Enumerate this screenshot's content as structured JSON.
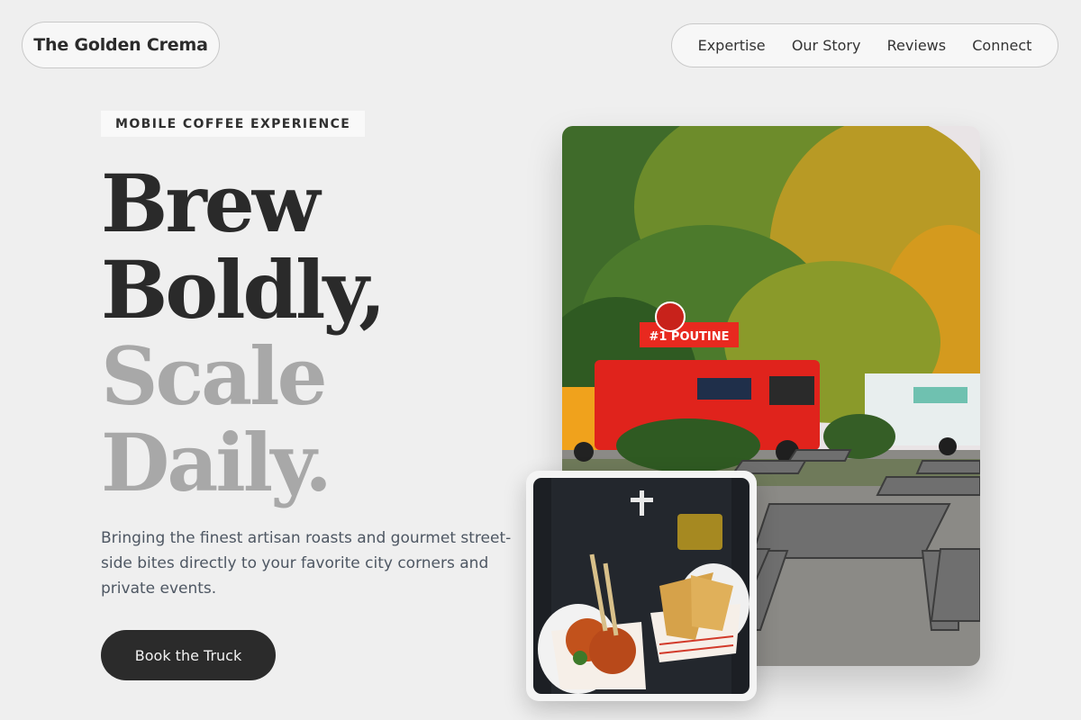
{
  "header": {
    "brand": "The Golden Crema",
    "nav": [
      "Expertise",
      "Our Story",
      "Reviews",
      "Connect"
    ]
  },
  "hero": {
    "badge": "MOBILE COFFEE EXPERIENCE",
    "headline_dark_1": "Brew",
    "headline_dark_2": "Boldly,",
    "headline_light_1": "Scale",
    "headline_light_2": "Daily.",
    "description": "Bringing the finest artisan roasts and gourmet street-side bites directly to your favorite city corners and private events.",
    "cta": "Book the Truck"
  },
  "images": {
    "main": {
      "description": "Red food truck parked under autumn trees beside picnic tables",
      "truck_sign": "#1 POUTINE"
    },
    "inset": {
      "description": "Hands in white gloves holding meatballs and samosas in paper trays"
    }
  },
  "colors": {
    "background": "#efefef",
    "text_dark": "#2a2a2a",
    "text_muted": "#a8a8a8",
    "button": "#2b2b2b"
  }
}
